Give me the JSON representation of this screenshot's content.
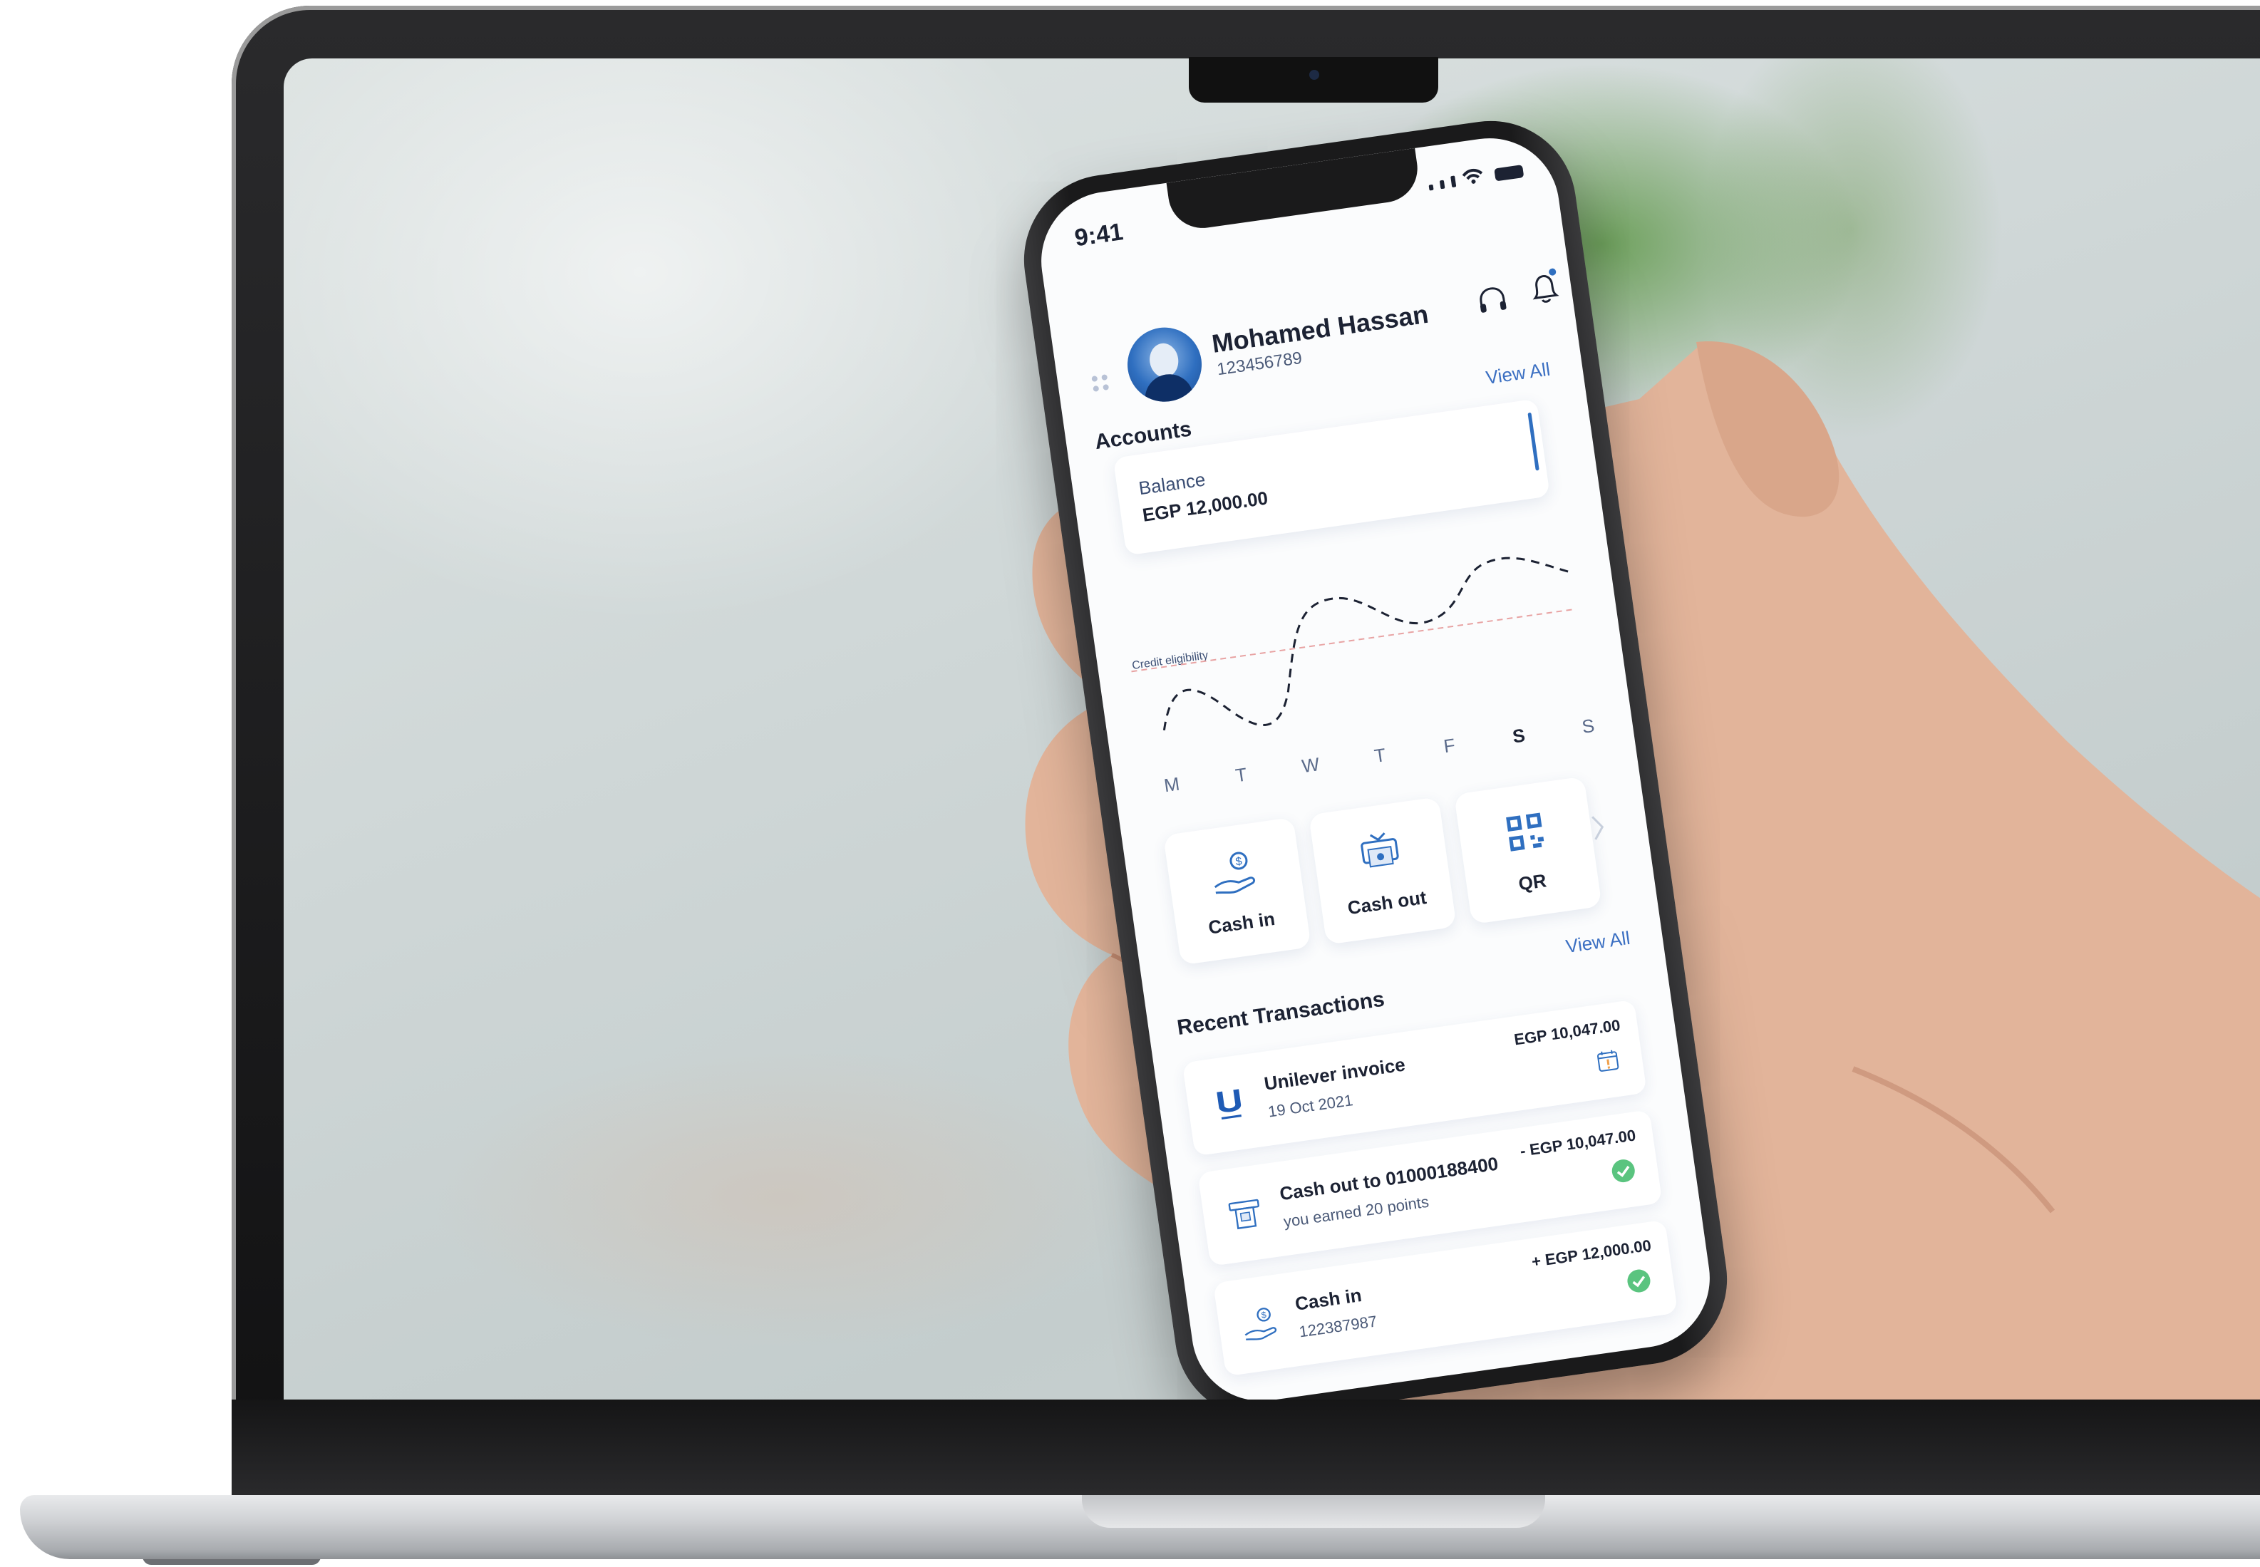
{
  "phone": {
    "status_time": "9:41",
    "user": {
      "name": "Mohamed Hassan",
      "id": "123456789"
    },
    "accounts": {
      "title": "Accounts",
      "view_all": "View All",
      "balance_label": "Balance",
      "balance_value": "EGP 12,000.00"
    },
    "chart_data": {
      "type": "line",
      "x": [
        "M",
        "T",
        "W",
        "T",
        "F",
        "S",
        "S"
      ],
      "threshold_label": "Credit eligibility",
      "highlighted_days": [
        "S",
        "S"
      ]
    },
    "quick_actions": [
      {
        "label": "Cash in",
        "icon": "cash-in-icon"
      },
      {
        "label": "Cash out",
        "icon": "cash-out-icon"
      },
      {
        "label": "QR",
        "icon": "qr-icon"
      }
    ],
    "transactions": {
      "title": "Recent Transactions",
      "view_all": "View All",
      "items": [
        {
          "title": "Unilever invoice",
          "subtitle": "19 Oct 2021",
          "amount": "EGP 10,047.00",
          "icon": "unilever-logo-icon",
          "status": "calendar-alert-icon"
        },
        {
          "title": "Cash out to 01000188400",
          "subtitle": "you earned 20 points",
          "amount": "- EGP 10,047.00",
          "icon": "atm-icon",
          "status": "check-icon"
        },
        {
          "title": "Cash in",
          "subtitle": "122387987",
          "amount": "+ EGP 12,000.00",
          "icon": "cash-in-icon",
          "status": "check-icon"
        }
      ]
    }
  },
  "colors": {
    "accent": "#2f6fc0",
    "text": "#1c2233",
    "success": "#5ac47f",
    "threshold": "#e8a3a3"
  }
}
